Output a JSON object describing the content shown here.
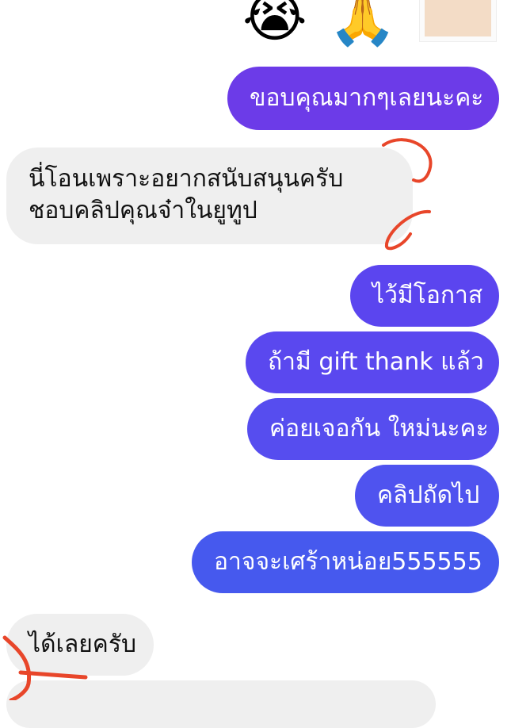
{
  "colors": {
    "outgoing_top": "#6c3be8",
    "outgoing_mid": "#5a48ef",
    "outgoing_bottom": "#4659ee",
    "incoming": "#efefef",
    "annotation": "#e8462a"
  },
  "top_row": {
    "emoji_1": "😭",
    "emoji_2": "🙏",
    "sticker_icon": "sticker-thumbnail"
  },
  "messages": [
    {
      "direction": "out",
      "text": "ขอบคุณมากๆเลยนะคะ"
    },
    {
      "direction": "in",
      "text": "นี่โอนเพราะอยากสนับสนุนครับ ชอบคลิปคุณจ๋าในยูทูป"
    },
    {
      "direction": "out",
      "text": "ไว้มีโอกาส"
    },
    {
      "direction": "out",
      "text": "ถ้ามี gift thank แล้ว"
    },
    {
      "direction": "out",
      "text": "ค่อยเจอกัน ใหม่นะคะ"
    },
    {
      "direction": "out",
      "text": "คลิปถัดไป"
    },
    {
      "direction": "out",
      "text": "อาจจะเศร้าหน่อย555555"
    },
    {
      "direction": "in",
      "text": "ได้เลยครับ"
    }
  ]
}
